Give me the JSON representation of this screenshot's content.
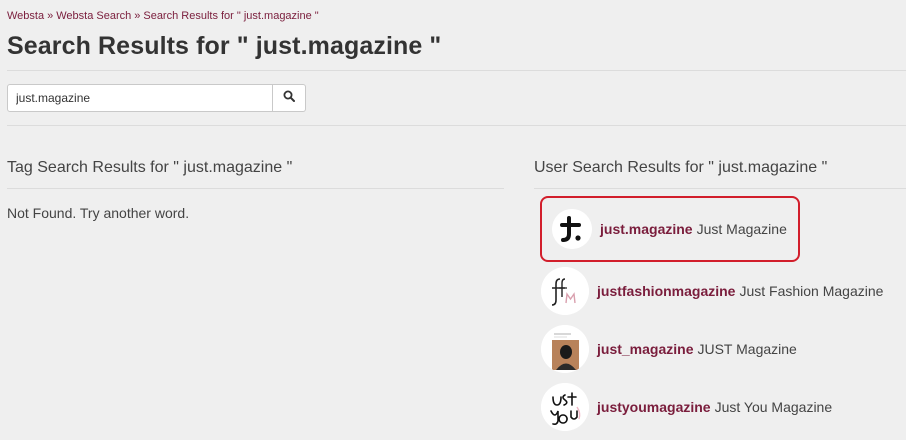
{
  "breadcrumb": {
    "items": [
      "Websta",
      "Websta Search",
      "Search Results for \" just.magazine \""
    ],
    "separator": "»"
  },
  "page_title": "Search Results for \" just.magazine \"",
  "search": {
    "value": "just.magazine",
    "placeholder": "",
    "button_icon": "search-icon"
  },
  "tag_results": {
    "heading": "Tag Search Results for \" just.magazine \"",
    "empty_message": "Not Found. Try another word."
  },
  "user_results": {
    "heading": "User Search Results for \" just.magazine \"",
    "items": [
      {
        "handle": "just.magazine",
        "name": "Just Magazine",
        "highlighted": true
      },
      {
        "handle": "justfashionmagazine",
        "name": "Just Fashion Magazine",
        "highlighted": false
      },
      {
        "handle": "just_magazine",
        "name": "JUST Magazine",
        "highlighted": false
      },
      {
        "handle": "justyoumagazine",
        "name": "Just You Magazine",
        "highlighted": false
      }
    ]
  },
  "colors": {
    "link": "#7a1d3c",
    "highlight_border": "#d21e2b",
    "background": "#efefef"
  }
}
